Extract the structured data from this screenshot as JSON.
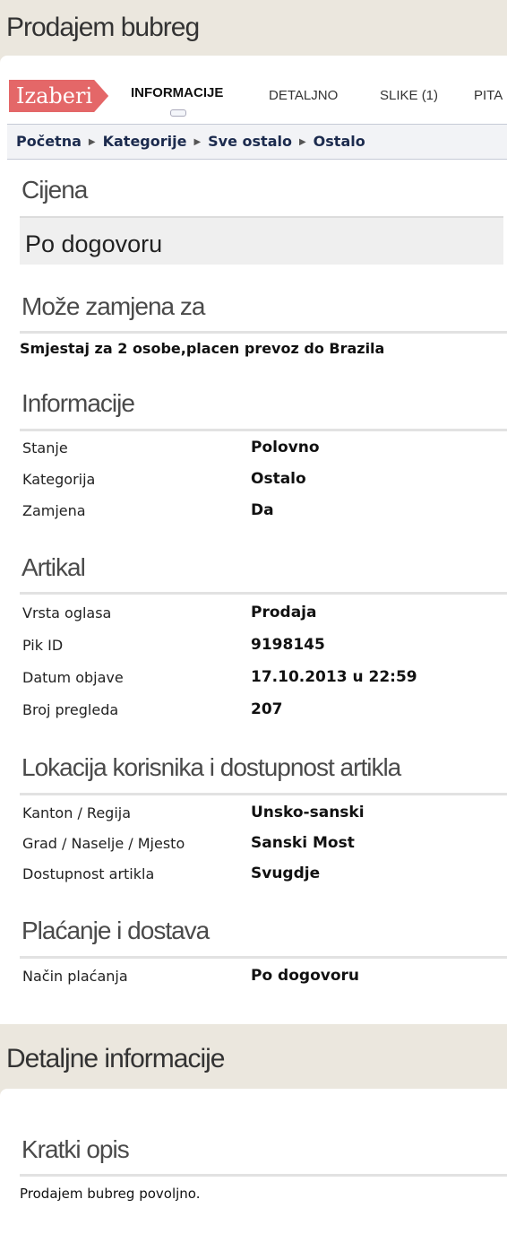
{
  "page": {
    "title": "Prodajem bubreg"
  },
  "tabs": {
    "izaberi": "Izaberi",
    "items": [
      "INFORMACIJE",
      "DETALJNO",
      "SLIKE (1)",
      "PITA"
    ]
  },
  "breadcrumb": [
    "Početna",
    "Kategorije",
    "Sve ostalo",
    "Ostalo"
  ],
  "price": {
    "heading": "Cijena",
    "value": "Po dogovoru"
  },
  "exchange": {
    "heading": "Može zamjena za",
    "text": "Smjestaj za 2 osobe,placen prevoz do Brazila"
  },
  "info": {
    "heading": "Informacije",
    "rows": [
      {
        "label": "Stanje",
        "value": "Polovno"
      },
      {
        "label": "Kategorija",
        "value": "Ostalo"
      },
      {
        "label": "Zamjena",
        "value": "Da"
      }
    ]
  },
  "article": {
    "heading": "Artikal",
    "rows": [
      {
        "label": "Vrsta oglasa",
        "value": "Prodaja"
      },
      {
        "label": "Pik ID",
        "value": "9198145"
      },
      {
        "label": "Datum objave",
        "value": "17.10.2013 u 22:59"
      },
      {
        "label": "Broj pregleda",
        "value": "207"
      }
    ]
  },
  "location": {
    "heading": "Lokacija korisnika i dostupnost artikla",
    "rows": [
      {
        "label": "Kanton / Regija",
        "value": "Unsko-sanski"
      },
      {
        "label": "Grad / Naselje / Mjesto",
        "value": "Sanski Most"
      },
      {
        "label": "Dostupnost artikla",
        "value": "Svugdje"
      }
    ]
  },
  "payment": {
    "heading": "Plaćanje i dostava",
    "rows": [
      {
        "label": "Način plaćanja",
        "value": "Po dogovoru"
      }
    ]
  },
  "details": {
    "title": "Detaljne informacije",
    "heading": "Kratki opis",
    "text": "Prodajem bubreg povoljno."
  },
  "colors": {
    "accent": "#e46768",
    "background": "#ebe7de",
    "breadcrumb_text": "#1c2b4e"
  }
}
